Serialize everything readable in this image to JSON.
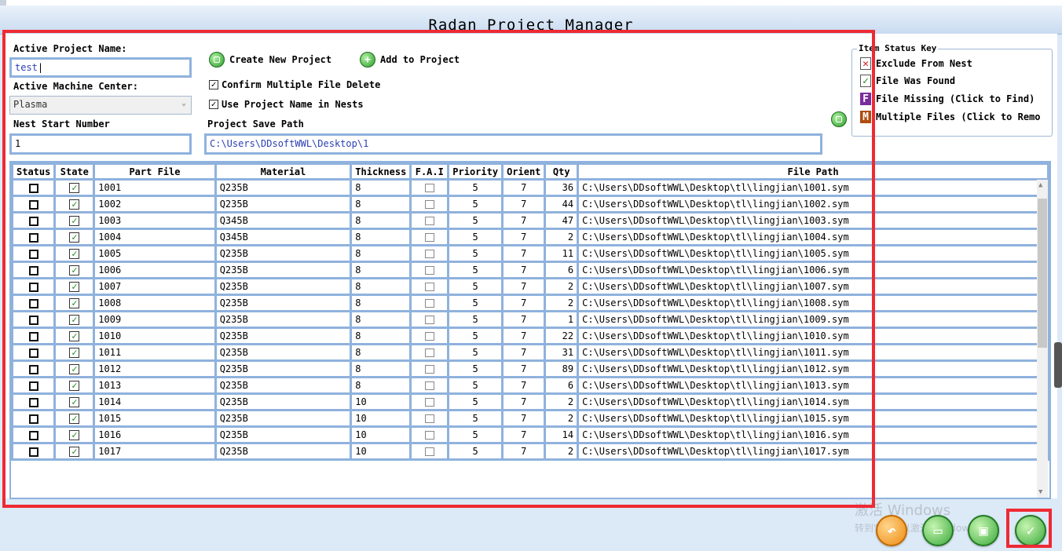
{
  "window": {
    "title": "Radan Project Manager"
  },
  "form": {
    "project_name_label": "Active Project Name:",
    "project_name_value": "test",
    "machine_center_label": "Active Machine Center:",
    "machine_center_value": "Plasma",
    "nest_start_label": "Nest Start Number",
    "nest_start_value": "1",
    "save_path_label": "Project Save Path",
    "save_path_value": "C:\\Users\\DDsoftWWL\\Desktop\\1",
    "create_project_label": "Create New Project",
    "add_to_project_label": "Add to Project",
    "confirm_delete_label": "Confirm Multiple File Delete",
    "confirm_delete_checked": true,
    "use_project_name_label": "Use Project Name in Nests",
    "use_project_name_checked": true
  },
  "status_key": {
    "title": "Item Status Key",
    "items": [
      {
        "label": "Exclude From Nest",
        "icon": "red-x-icon",
        "glyph": "✕"
      },
      {
        "label": "File Was Found",
        "icon": "green-check-icon",
        "glyph": "✓"
      },
      {
        "label": "File Missing (Click to Find)",
        "icon": "purple-f-icon",
        "glyph": "F"
      },
      {
        "label": "Multiple Files (Click to Remo",
        "icon": "orange-m-icon",
        "glyph": "M"
      }
    ]
  },
  "table": {
    "columns": [
      "Status",
      "State",
      "Part File",
      "Material",
      "Thickness",
      "F.A.I",
      "Priority",
      "Orient",
      "Qty",
      "File Path"
    ],
    "rows": [
      {
        "part": "1001",
        "material": "Q235B",
        "thickness": "8",
        "priority": "5",
        "orient": "7",
        "qty": "36",
        "path": "C:\\Users\\DDsoftWWL\\Desktop\\tl\\lingjian\\1001.sym"
      },
      {
        "part": "1002",
        "material": "Q235B",
        "thickness": "8",
        "priority": "5",
        "orient": "7",
        "qty": "44",
        "path": "C:\\Users\\DDsoftWWL\\Desktop\\tl\\lingjian\\1002.sym"
      },
      {
        "part": "1003",
        "material": "Q345B",
        "thickness": "8",
        "priority": "5",
        "orient": "7",
        "qty": "47",
        "path": "C:\\Users\\DDsoftWWL\\Desktop\\tl\\lingjian\\1003.sym"
      },
      {
        "part": "1004",
        "material": "Q345B",
        "thickness": "8",
        "priority": "5",
        "orient": "7",
        "qty": "2",
        "path": "C:\\Users\\DDsoftWWL\\Desktop\\tl\\lingjian\\1004.sym"
      },
      {
        "part": "1005",
        "material": "Q235B",
        "thickness": "8",
        "priority": "5",
        "orient": "7",
        "qty": "11",
        "path": "C:\\Users\\DDsoftWWL\\Desktop\\tl\\lingjian\\1005.sym"
      },
      {
        "part": "1006",
        "material": "Q235B",
        "thickness": "8",
        "priority": "5",
        "orient": "7",
        "qty": "6",
        "path": "C:\\Users\\DDsoftWWL\\Desktop\\tl\\lingjian\\1006.sym"
      },
      {
        "part": "1007",
        "material": "Q235B",
        "thickness": "8",
        "priority": "5",
        "orient": "7",
        "qty": "2",
        "path": "C:\\Users\\DDsoftWWL\\Desktop\\tl\\lingjian\\1007.sym"
      },
      {
        "part": "1008",
        "material": "Q235B",
        "thickness": "8",
        "priority": "5",
        "orient": "7",
        "qty": "2",
        "path": "C:\\Users\\DDsoftWWL\\Desktop\\tl\\lingjian\\1008.sym"
      },
      {
        "part": "1009",
        "material": "Q235B",
        "thickness": "8",
        "priority": "5",
        "orient": "7",
        "qty": "1",
        "path": "C:\\Users\\DDsoftWWL\\Desktop\\tl\\lingjian\\1009.sym"
      },
      {
        "part": "1010",
        "material": "Q235B",
        "thickness": "8",
        "priority": "5",
        "orient": "7",
        "qty": "22",
        "path": "C:\\Users\\DDsoftWWL\\Desktop\\tl\\lingjian\\1010.sym"
      },
      {
        "part": "1011",
        "material": "Q235B",
        "thickness": "8",
        "priority": "5",
        "orient": "7",
        "qty": "31",
        "path": "C:\\Users\\DDsoftWWL\\Desktop\\tl\\lingjian\\1011.sym"
      },
      {
        "part": "1012",
        "material": "Q235B",
        "thickness": "8",
        "priority": "5",
        "orient": "7",
        "qty": "89",
        "path": "C:\\Users\\DDsoftWWL\\Desktop\\tl\\lingjian\\1012.sym"
      },
      {
        "part": "1013",
        "material": "Q235B",
        "thickness": "8",
        "priority": "5",
        "orient": "7",
        "qty": "6",
        "path": "C:\\Users\\DDsoftWWL\\Desktop\\tl\\lingjian\\1013.sym"
      },
      {
        "part": "1014",
        "material": "Q235B",
        "thickness": "10",
        "priority": "5",
        "orient": "7",
        "qty": "2",
        "path": "C:\\Users\\DDsoftWWL\\Desktop\\tl\\lingjian\\1014.sym"
      },
      {
        "part": "1015",
        "material": "Q235B",
        "thickness": "10",
        "priority": "5",
        "orient": "7",
        "qty": "2",
        "path": "C:\\Users\\DDsoftWWL\\Desktop\\tl\\lingjian\\1015.sym"
      },
      {
        "part": "1016",
        "material": "Q235B",
        "thickness": "10",
        "priority": "5",
        "orient": "7",
        "qty": "14",
        "path": "C:\\Users\\DDsoftWWL\\Desktop\\tl\\lingjian\\1016.sym"
      },
      {
        "part": "1017",
        "material": "Q235B",
        "thickness": "10",
        "priority": "5",
        "orient": "7",
        "qty": "2",
        "path": "C:\\Users\\DDsoftWWL\\Desktop\\tl\\lingjian\\1017.sym"
      }
    ]
  },
  "watermark": {
    "line1": "激活 Windows",
    "line2": "转到\"设置\"以激活 Windows。"
  },
  "bottom_buttons": [
    {
      "name": "undo-button",
      "icon": "undo-icon",
      "glyph": "↶",
      "color": "#ee8a12"
    },
    {
      "name": "open-button",
      "icon": "folder-icon",
      "glyph": "▭",
      "color": "#3aa83a"
    },
    {
      "name": "save-button",
      "icon": "save-icon",
      "glyph": "▣",
      "color": "#3aa83a"
    },
    {
      "name": "ok-button",
      "icon": "check-icon",
      "glyph": "✓",
      "color": "#3aa83a"
    }
  ]
}
